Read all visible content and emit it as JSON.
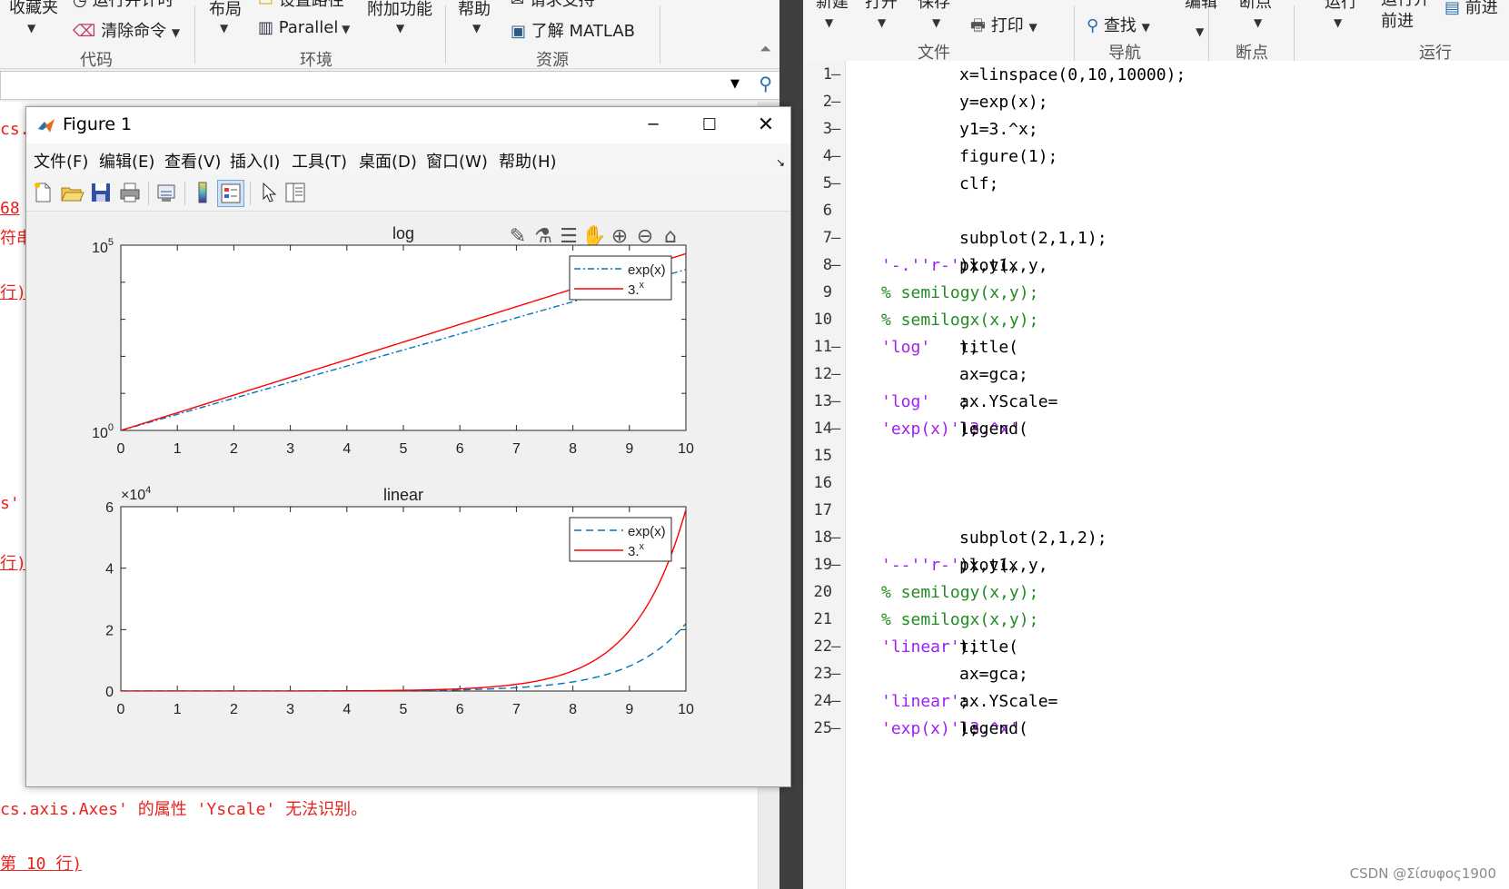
{
  "background": {
    "toolstrip": {
      "items": [
        {
          "id": "favorites",
          "label": "收藏夹"
        },
        {
          "id": "run-section",
          "label": "运行并计时"
        },
        {
          "id": "clear-commands",
          "label": "清除命令"
        },
        {
          "id": "layout",
          "label": "布局"
        },
        {
          "id": "set-path",
          "label": "设置路径"
        },
        {
          "id": "parallel",
          "label": "Parallel"
        },
        {
          "id": "add-ons",
          "label": "附加功能"
        },
        {
          "id": "help",
          "label": "帮助"
        },
        {
          "id": "request-support",
          "label": "请求支持"
        },
        {
          "id": "learn-matlab",
          "label": "了解 MATLAB"
        }
      ],
      "groups": [
        {
          "id": "code",
          "label": "代码"
        },
        {
          "id": "environment",
          "label": "环境"
        },
        {
          "id": "resources",
          "label": "资源"
        }
      ]
    },
    "command_window": {
      "lines": [
        {
          "text": "cs.",
          "style": "plain"
        },
        {
          "text": "68",
          "style": "underline"
        },
        {
          "text": "符串",
          "style": "plain"
        },
        {
          "text": "行)",
          "style": "underline"
        },
        {
          "text": "s'",
          "style": "plain"
        },
        {
          "text": "行)",
          "style": "underline"
        },
        {
          "text": "cs.axis.Axes' 的属性 'Yscale' 无法识别。",
          "style": "plain"
        },
        {
          "text": "第 10 行)",
          "style": "underline"
        }
      ]
    }
  },
  "editor": {
    "toolstrip": {
      "items": [
        {
          "id": "new",
          "label": "新建"
        },
        {
          "id": "open",
          "label": "打开"
        },
        {
          "id": "save",
          "label": "保存"
        },
        {
          "id": "print",
          "label": "打印"
        },
        {
          "id": "find",
          "label": "查找"
        },
        {
          "id": "edit",
          "label": "编辑"
        },
        {
          "id": "breakpoints",
          "label": "断点"
        },
        {
          "id": "run",
          "label": "运行"
        },
        {
          "id": "run-advance",
          "label": "运行并前进"
        },
        {
          "id": "advance",
          "label": "前进"
        }
      ],
      "groups": [
        {
          "id": "file",
          "label": "文件"
        },
        {
          "id": "navigate",
          "label": "导航"
        },
        {
          "id": "breakpoints-group",
          "label": "断点"
        },
        {
          "id": "run-group",
          "label": "运行"
        }
      ]
    },
    "lines": [
      {
        "n": "1",
        "dash": true,
        "parts": [
          {
            "t": "x=linspace(0,10,10000);",
            "c": "code"
          }
        ]
      },
      {
        "n": "2",
        "dash": true,
        "parts": [
          {
            "t": "y=exp(x);",
            "c": "code"
          }
        ]
      },
      {
        "n": "3",
        "dash": true,
        "parts": [
          {
            "t": "y1=3.^x;",
            "c": "code"
          }
        ]
      },
      {
        "n": "4",
        "dash": true,
        "parts": [
          {
            "t": "figure(1);",
            "c": "code"
          }
        ]
      },
      {
        "n": "5",
        "dash": true,
        "parts": [
          {
            "t": "clf;",
            "c": "code"
          }
        ]
      },
      {
        "n": "6",
        "dash": false,
        "parts": []
      },
      {
        "n": "7",
        "dash": true,
        "parts": [
          {
            "t": "subplot(2,1,1);",
            "c": "code"
          }
        ]
      },
      {
        "n": "8",
        "dash": true,
        "parts": [
          {
            "t": "plot(x,y,",
            "c": "code"
          },
          {
            "t": "'-.'",
            "c": "str"
          },
          {
            "t": ",x,y1,",
            "c": "code"
          },
          {
            "t": "'r-'",
            "c": "str"
          },
          {
            "t": ");",
            "c": "code"
          }
        ]
      },
      {
        "n": "9",
        "dash": false,
        "parts": [
          {
            "t": "% semilogy(x,y);",
            "c": "cmt"
          }
        ]
      },
      {
        "n": "10",
        "dash": false,
        "parts": [
          {
            "t": "% semilogx(x,y);",
            "c": "cmt"
          }
        ]
      },
      {
        "n": "11",
        "dash": true,
        "parts": [
          {
            "t": "title(",
            "c": "code"
          },
          {
            "t": "'log'",
            "c": "str"
          },
          {
            "t": ");",
            "c": "code"
          }
        ]
      },
      {
        "n": "12",
        "dash": true,
        "parts": [
          {
            "t": "ax=gca;",
            "c": "code"
          }
        ]
      },
      {
        "n": "13",
        "dash": true,
        "parts": [
          {
            "t": "ax.YScale=",
            "c": "code"
          },
          {
            "t": "'log'",
            "c": "str"
          },
          {
            "t": ";",
            "c": "code"
          }
        ]
      },
      {
        "n": "14",
        "dash": true,
        "parts": [
          {
            "t": "legend(",
            "c": "code"
          },
          {
            "t": "'exp(x)'",
            "c": "str"
          },
          {
            "t": ",",
            "c": "code"
          },
          {
            "t": "'3.^x'",
            "c": "str"
          },
          {
            "t": ");",
            "c": "code"
          }
        ]
      },
      {
        "n": "15",
        "dash": false,
        "parts": []
      },
      {
        "n": "16",
        "dash": false,
        "parts": []
      },
      {
        "n": "17",
        "dash": false,
        "parts": []
      },
      {
        "n": "18",
        "dash": true,
        "parts": [
          {
            "t": "subplot(2,1,2);",
            "c": "code"
          }
        ]
      },
      {
        "n": "19",
        "dash": true,
        "parts": [
          {
            "t": "plot(x,y,",
            "c": "code"
          },
          {
            "t": "'--'",
            "c": "str"
          },
          {
            "t": ",x,y1,",
            "c": "code"
          },
          {
            "t": "'r-'",
            "c": "str"
          },
          {
            "t": ");",
            "c": "code"
          }
        ]
      },
      {
        "n": "20",
        "dash": false,
        "parts": [
          {
            "t": "% semilogy(x,y);",
            "c": "cmt"
          }
        ]
      },
      {
        "n": "21",
        "dash": false,
        "parts": [
          {
            "t": "% semilogx(x,y);",
            "c": "cmt"
          }
        ]
      },
      {
        "n": "22",
        "dash": true,
        "parts": [
          {
            "t": "title(",
            "c": "code"
          },
          {
            "t": "'linear'",
            "c": "str"
          },
          {
            "t": ");",
            "c": "code"
          }
        ]
      },
      {
        "n": "23",
        "dash": true,
        "parts": [
          {
            "t": "ax=gca;",
            "c": "code"
          }
        ]
      },
      {
        "n": "24",
        "dash": true,
        "parts": [
          {
            "t": "ax.YScale=",
            "c": "code"
          },
          {
            "t": "'linear'",
            "c": "str"
          },
          {
            "t": ";",
            "c": "code"
          }
        ]
      },
      {
        "n": "25",
        "dash": true,
        "parts": [
          {
            "t": "legend(",
            "c": "code"
          },
          {
            "t": "'exp(x)'",
            "c": "str"
          },
          {
            "t": ",",
            "c": "code"
          },
          {
            "t": "'3.^x'",
            "c": "str"
          },
          {
            "t": ");",
            "c": "code"
          }
        ]
      }
    ],
    "watermark": "CSDN @Σίσυφος1900"
  },
  "figure": {
    "title": "Figure 1",
    "menu": [
      {
        "id": "file",
        "label": "文件(F)"
      },
      {
        "id": "edit",
        "label": "编辑(E)"
      },
      {
        "id": "view",
        "label": "查看(V)"
      },
      {
        "id": "insert",
        "label": "插入(I)"
      },
      {
        "id": "tools",
        "label": "工具(T)"
      },
      {
        "id": "desktop",
        "label": "桌面(D)"
      },
      {
        "id": "window",
        "label": "窗口(W)"
      },
      {
        "id": "help",
        "label": "帮助(H)"
      }
    ],
    "toolbar_icons": [
      "new-figure-icon",
      "open-file-icon",
      "save-icon",
      "print-icon",
      "link-icon",
      "colorbar-icon",
      "legend-icon",
      "select-pointer-icon",
      "property-inspector-icon"
    ],
    "axes_toolbar_icons": [
      "export-icon",
      "brush-icon",
      "data-tips-icon",
      "pan-icon",
      "zoom-in-icon",
      "zoom-out-icon",
      "restore-view-icon"
    ]
  },
  "colors": {
    "exp_series": "#0072bd",
    "pow3_series": "#ff0000"
  },
  "chart_data": [
    {
      "type": "line",
      "title": "log",
      "xlim": [
        0,
        10
      ],
      "ylim": [
        1,
        100000
      ],
      "yscale": "log",
      "xticks": [
        0,
        1,
        2,
        3,
        4,
        5,
        6,
        7,
        8,
        9,
        10
      ],
      "yticks": [
        {
          "value": 1,
          "base": "10",
          "exp": "0"
        },
        {
          "value": 100000,
          "base": "10",
          "exp": "5"
        }
      ],
      "legend": {
        "location": "top-right",
        "entries": [
          {
            "label": "exp(x)",
            "super": ""
          },
          {
            "label": "3.",
            "super": "x"
          }
        ]
      },
      "series": [
        {
          "name": "exp(x)",
          "style": "dash-dot",
          "color": "#0072bd",
          "x": [
            0,
            1,
            2,
            3,
            4,
            5,
            6,
            7,
            8,
            9,
            10
          ],
          "y": [
            1,
            2.718,
            7.389,
            20.09,
            54.6,
            148.4,
            403.4,
            1096.6,
            2981,
            8103,
            22026
          ]
        },
        {
          "name": "3.^x",
          "style": "solid",
          "color": "#ff0000",
          "x": [
            0,
            1,
            2,
            3,
            4,
            5,
            6,
            7,
            8,
            9,
            10
          ],
          "y": [
            1,
            3,
            9,
            27,
            81,
            243,
            729,
            2187,
            6561,
            19683,
            59049
          ]
        }
      ]
    },
    {
      "type": "line",
      "title": "linear",
      "xlim": [
        0,
        10
      ],
      "ylim": [
        0,
        60000
      ],
      "yscale": "linear",
      "exponent_label": {
        "prefix": "×10",
        "exp": "4"
      },
      "xticks": [
        0,
        1,
        2,
        3,
        4,
        5,
        6,
        7,
        8,
        9,
        10
      ],
      "yticks": [
        {
          "value": 0,
          "label": "0"
        },
        {
          "value": 20000,
          "label": "2"
        },
        {
          "value": 40000,
          "label": "4"
        },
        {
          "value": 60000,
          "label": "6"
        }
      ],
      "legend": {
        "location": "top-right",
        "entries": [
          {
            "label": "exp(x)",
            "super": ""
          },
          {
            "label": "3.",
            "super": "x"
          }
        ]
      },
      "series": [
        {
          "name": "exp(x)",
          "style": "dashed",
          "color": "#0072bd",
          "x": [
            0,
            1,
            2,
            3,
            4,
            5,
            6,
            7,
            8,
            9,
            10
          ],
          "y": [
            1,
            2.718,
            7.389,
            20.09,
            54.6,
            148.4,
            403.4,
            1096.6,
            2981,
            8103,
            22026
          ]
        },
        {
          "name": "3.^x",
          "style": "solid",
          "color": "#ff0000",
          "x": [
            0,
            1,
            2,
            3,
            4,
            5,
            6,
            7,
            8,
            9,
            10
          ],
          "y": [
            1,
            3,
            9,
            27,
            81,
            243,
            729,
            2187,
            6561,
            19683,
            59049
          ]
        }
      ]
    }
  ]
}
